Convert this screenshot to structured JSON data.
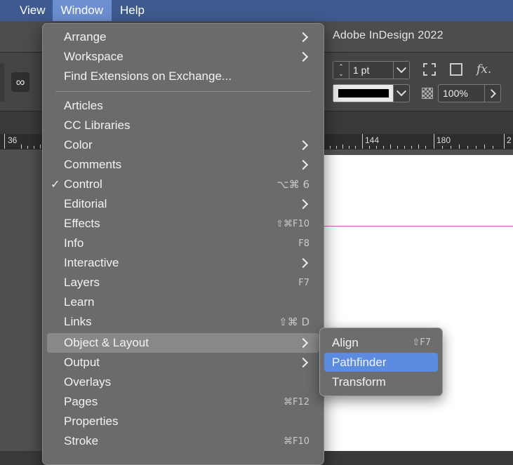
{
  "menubar": {
    "items": [
      "View",
      "Window",
      "Help"
    ],
    "active": "Window"
  },
  "app": {
    "title": "Adobe InDesign 2022"
  },
  "control_panel": {
    "stroke_weight": "1 pt",
    "opacity": "100%",
    "fx_label": "fx."
  },
  "ruler": {
    "labels": [
      "36",
      "144",
      "180",
      "2"
    ]
  },
  "window_menu": {
    "items": [
      {
        "label": "Arrange",
        "submenu": true
      },
      {
        "label": "Workspace",
        "submenu": true
      },
      {
        "label": "Find Extensions on Exchange..."
      },
      {
        "label": "Articles"
      },
      {
        "label": "CC Libraries"
      },
      {
        "label": "Color",
        "submenu": true
      },
      {
        "label": "Comments",
        "submenu": true
      },
      {
        "label": "Control",
        "checked": true,
        "shortcut": "⌥⌘ 6"
      },
      {
        "label": "Editorial",
        "submenu": true
      },
      {
        "label": "Effects",
        "shortcut": "⇧⌘F10"
      },
      {
        "label": "Info",
        "shortcut": "F8"
      },
      {
        "label": "Interactive",
        "submenu": true
      },
      {
        "label": "Layers",
        "shortcut": "F7"
      },
      {
        "label": "Learn"
      },
      {
        "label": "Links",
        "shortcut": "⇧⌘ D"
      },
      {
        "label": "Object & Layout",
        "submenu": true,
        "highlighted": true
      },
      {
        "label": "Output",
        "submenu": true
      },
      {
        "label": "Overlays"
      },
      {
        "label": "Pages",
        "shortcut": "⌘F12"
      },
      {
        "label": "Properties"
      },
      {
        "label": "Stroke",
        "shortcut": "⌘F10"
      }
    ]
  },
  "object_layout_submenu": {
    "items": [
      {
        "label": "Align",
        "shortcut": "⇧F7"
      },
      {
        "label": "Pathfinder",
        "selected": true
      },
      {
        "label": "Transform"
      }
    ]
  },
  "colors": {
    "menubar": "#3e5a8e",
    "selection": "#5b8ce0",
    "margin_guide": "#d060d0"
  }
}
